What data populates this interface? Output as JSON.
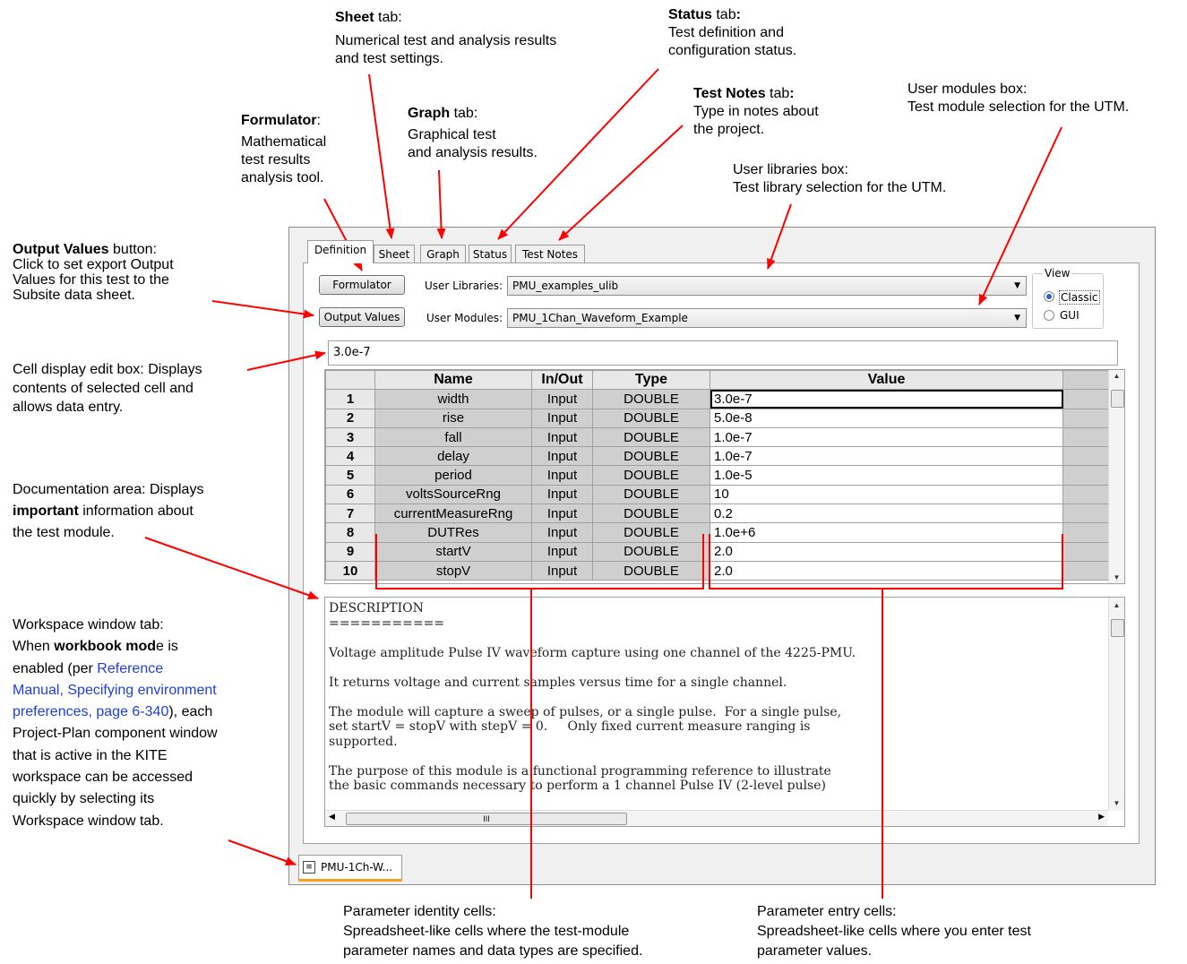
{
  "annotations": {
    "sheet_tab": {
      "bold": "Sheet",
      "rest": " tab:",
      "lines": [
        "Numerical test and analysis results",
        "and test settings."
      ]
    },
    "status_tab": {
      "bold": "Status",
      "rest": " tab",
      "colon": ":",
      "lines": [
        "Test definition and",
        "configuration status."
      ]
    },
    "test_notes_tab": {
      "bold": "Test Notes",
      "rest": " tab",
      "colon": ":",
      "lines": [
        "Type in notes about",
        "the project."
      ]
    },
    "user_modules_box": {
      "lines": [
        "User modules box:",
        "Test module selection for the UTM."
      ]
    },
    "formulator": {
      "bold": "Formulator",
      "rest": ":",
      "lines": [
        "Mathematical",
        "test results",
        "analysis tool."
      ]
    },
    "graph_tab": {
      "bold": "Graph",
      "rest": " tab:",
      "lines": [
        "Graphical test",
        "and analysis results."
      ]
    },
    "user_libraries_box": {
      "lines": [
        "User libraries box:",
        "Test library selection for the UTM."
      ]
    },
    "output_values": {
      "bold": "Output Values",
      "rest": " button:",
      "lines": [
        "Click to set export Output",
        "Values for this test to the",
        "Subsite data sheet."
      ]
    },
    "cell_display": {
      "lines": [
        "Cell display edit box:  Displays",
        "contents of selected cell and",
        "allows data entry."
      ]
    },
    "documentation": {
      "line1": "Documentation area:  Displays",
      "bold": "important",
      "rest": " information about",
      "line3": "the test module."
    },
    "workspace": {
      "line1": "Workspace window tab:",
      "l2a": "When ",
      "l2bold": "workbook mod",
      "l2b": "e is",
      "l3a": "enabled (per ",
      "l3link": "Reference",
      "l4link": "Manual, Specifying environment",
      "l5link": "preferences, page 6-340",
      "l5b": "), each",
      "rest": [
        "Project-Plan component window",
        "that is active in the KITE",
        "workspace can be accessed",
        "quickly by selecting its",
        "Workspace window tab."
      ]
    },
    "param_identity": {
      "lines": [
        "Parameter identity cells:",
        "Spreadsheet-like cells where the test-module",
        "parameter names and data types are specified."
      ]
    },
    "param_entry": {
      "lines": [
        "Parameter entry cells:",
        "Spreadsheet-like cells where you enter test",
        "parameter values."
      ]
    }
  },
  "tabs": [
    "Definition",
    "Sheet",
    "Graph",
    "Status",
    "Test Notes"
  ],
  "buttons": {
    "formulator": "Formulator",
    "output_values": "Output Values"
  },
  "user_libraries": {
    "label": "User Libraries:",
    "value": "PMU_examples_ulib"
  },
  "user_modules": {
    "label": "User Modules:",
    "value": "PMU_1Chan_Waveform_Example"
  },
  "view": {
    "label": "View",
    "options": [
      "Classic",
      "GUI"
    ],
    "selected": "Classic"
  },
  "cell_edit_value": "3.0e-7",
  "grid": {
    "headers": [
      "Name",
      "In/Out",
      "Type",
      "Value"
    ],
    "rows": [
      {
        "n": "1",
        "name": "width",
        "io": "Input",
        "type": "DOUBLE",
        "value": "3.0e-7"
      },
      {
        "n": "2",
        "name": "rise",
        "io": "Input",
        "type": "DOUBLE",
        "value": "5.0e-8"
      },
      {
        "n": "3",
        "name": "fall",
        "io": "Input",
        "type": "DOUBLE",
        "value": "1.0e-7"
      },
      {
        "n": "4",
        "name": "delay",
        "io": "Input",
        "type": "DOUBLE",
        "value": "1.0e-7"
      },
      {
        "n": "5",
        "name": "period",
        "io": "Input",
        "type": "DOUBLE",
        "value": "1.0e-5"
      },
      {
        "n": "6",
        "name": "voltsSourceRng",
        "io": "Input",
        "type": "DOUBLE",
        "value": "10"
      },
      {
        "n": "7",
        "name": "currentMeasureRng",
        "io": "Input",
        "type": "DOUBLE",
        "value": "0.2"
      },
      {
        "n": "8",
        "name": "DUTRes",
        "io": "Input",
        "type": "DOUBLE",
        "value": "1.0e+6"
      },
      {
        "n": "9",
        "name": "startV",
        "io": "Input",
        "type": "DOUBLE",
        "value": "2.0"
      },
      {
        "n": "10",
        "name": "stopV",
        "io": "Input",
        "type": "DOUBLE",
        "value": "2.0"
      }
    ]
  },
  "documentation_text": [
    "DESCRIPTION",
    "===========",
    "",
    "Voltage amplitude Pulse IV waveform capture using one channel of the 4225-PMU.",
    "",
    "It returns voltage and current samples versus time for a single channel.",
    "",
    "The module will capture a sweep of pulses, or a single pulse.  For a single pulse,",
    "set startV = stopV with stepV = 0.     Only fixed current measure ranging is",
    "supported.",
    "",
    "The purpose of this module is a functional programming reference to illustrate",
    "the basic commands necessary to perform a 1 channel Pulse IV (2-level pulse)"
  ],
  "hscroll_grip": "III",
  "workspace_tab": "PMU-1Ch-W...",
  "colors": {
    "arrow": "#ff0000",
    "link": "#1d3fd6",
    "tab_accent": "#f3a31d"
  }
}
